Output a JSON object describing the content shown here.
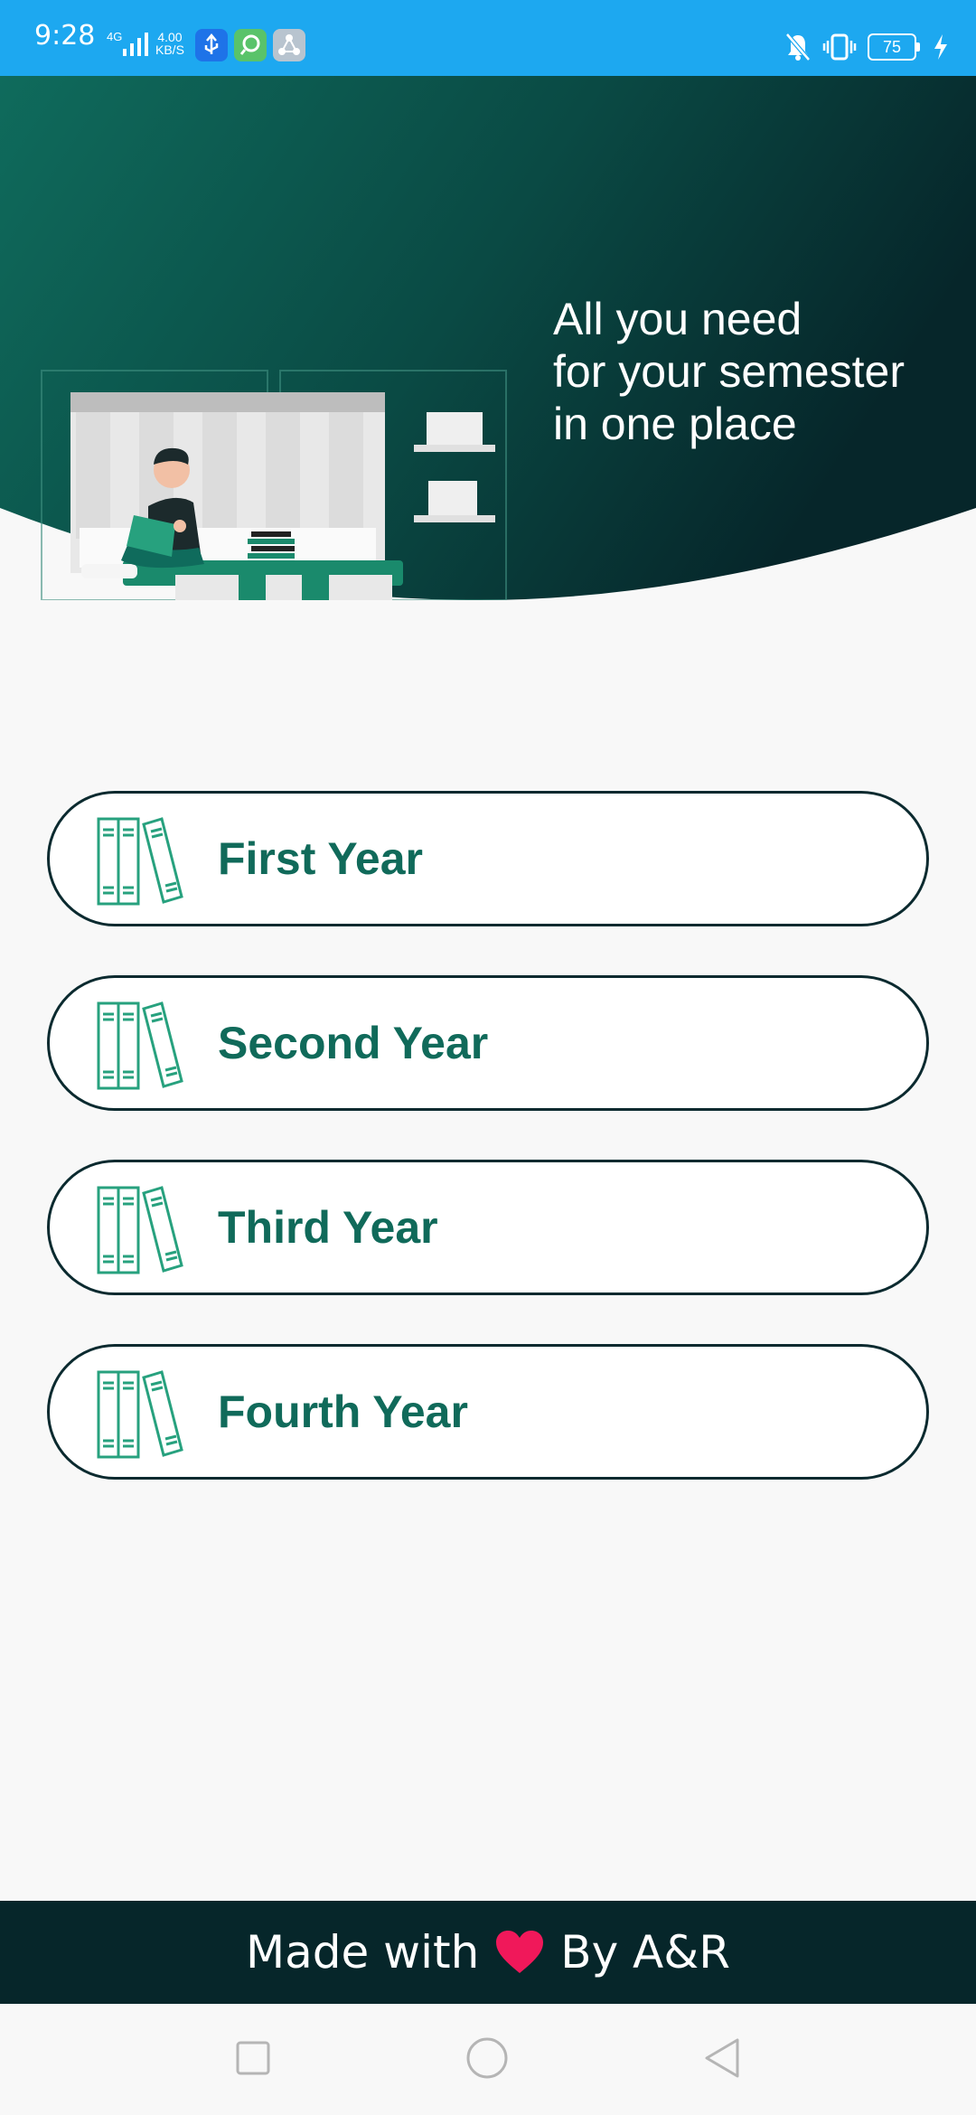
{
  "status_bar": {
    "time": "9:28",
    "network": "4G",
    "speed_value": "4.00",
    "speed_unit": "KB/S",
    "battery": "75"
  },
  "hero": {
    "tagline": [
      "All you need",
      "for your semester",
      "in one place"
    ]
  },
  "years": [
    {
      "label": "First Year"
    },
    {
      "label": "Second Year"
    },
    {
      "label": "Third Year"
    },
    {
      "label": "Fourth Year"
    }
  ],
  "footer": {
    "made_with": "Made with",
    "by": "By A&R"
  },
  "colors": {
    "status_bar": "#1da8f0",
    "header_gradient_start": "#0f6b5c",
    "header_gradient_end": "#06262a",
    "accent_text": "#106a5a",
    "heart": "#f0185a",
    "footer_bg": "#06262a"
  },
  "icons": {
    "year_button": "books-icon",
    "footer": "heart-icon",
    "nav": [
      "square-recents-icon",
      "circle-home-icon",
      "triangle-back-icon"
    ]
  }
}
